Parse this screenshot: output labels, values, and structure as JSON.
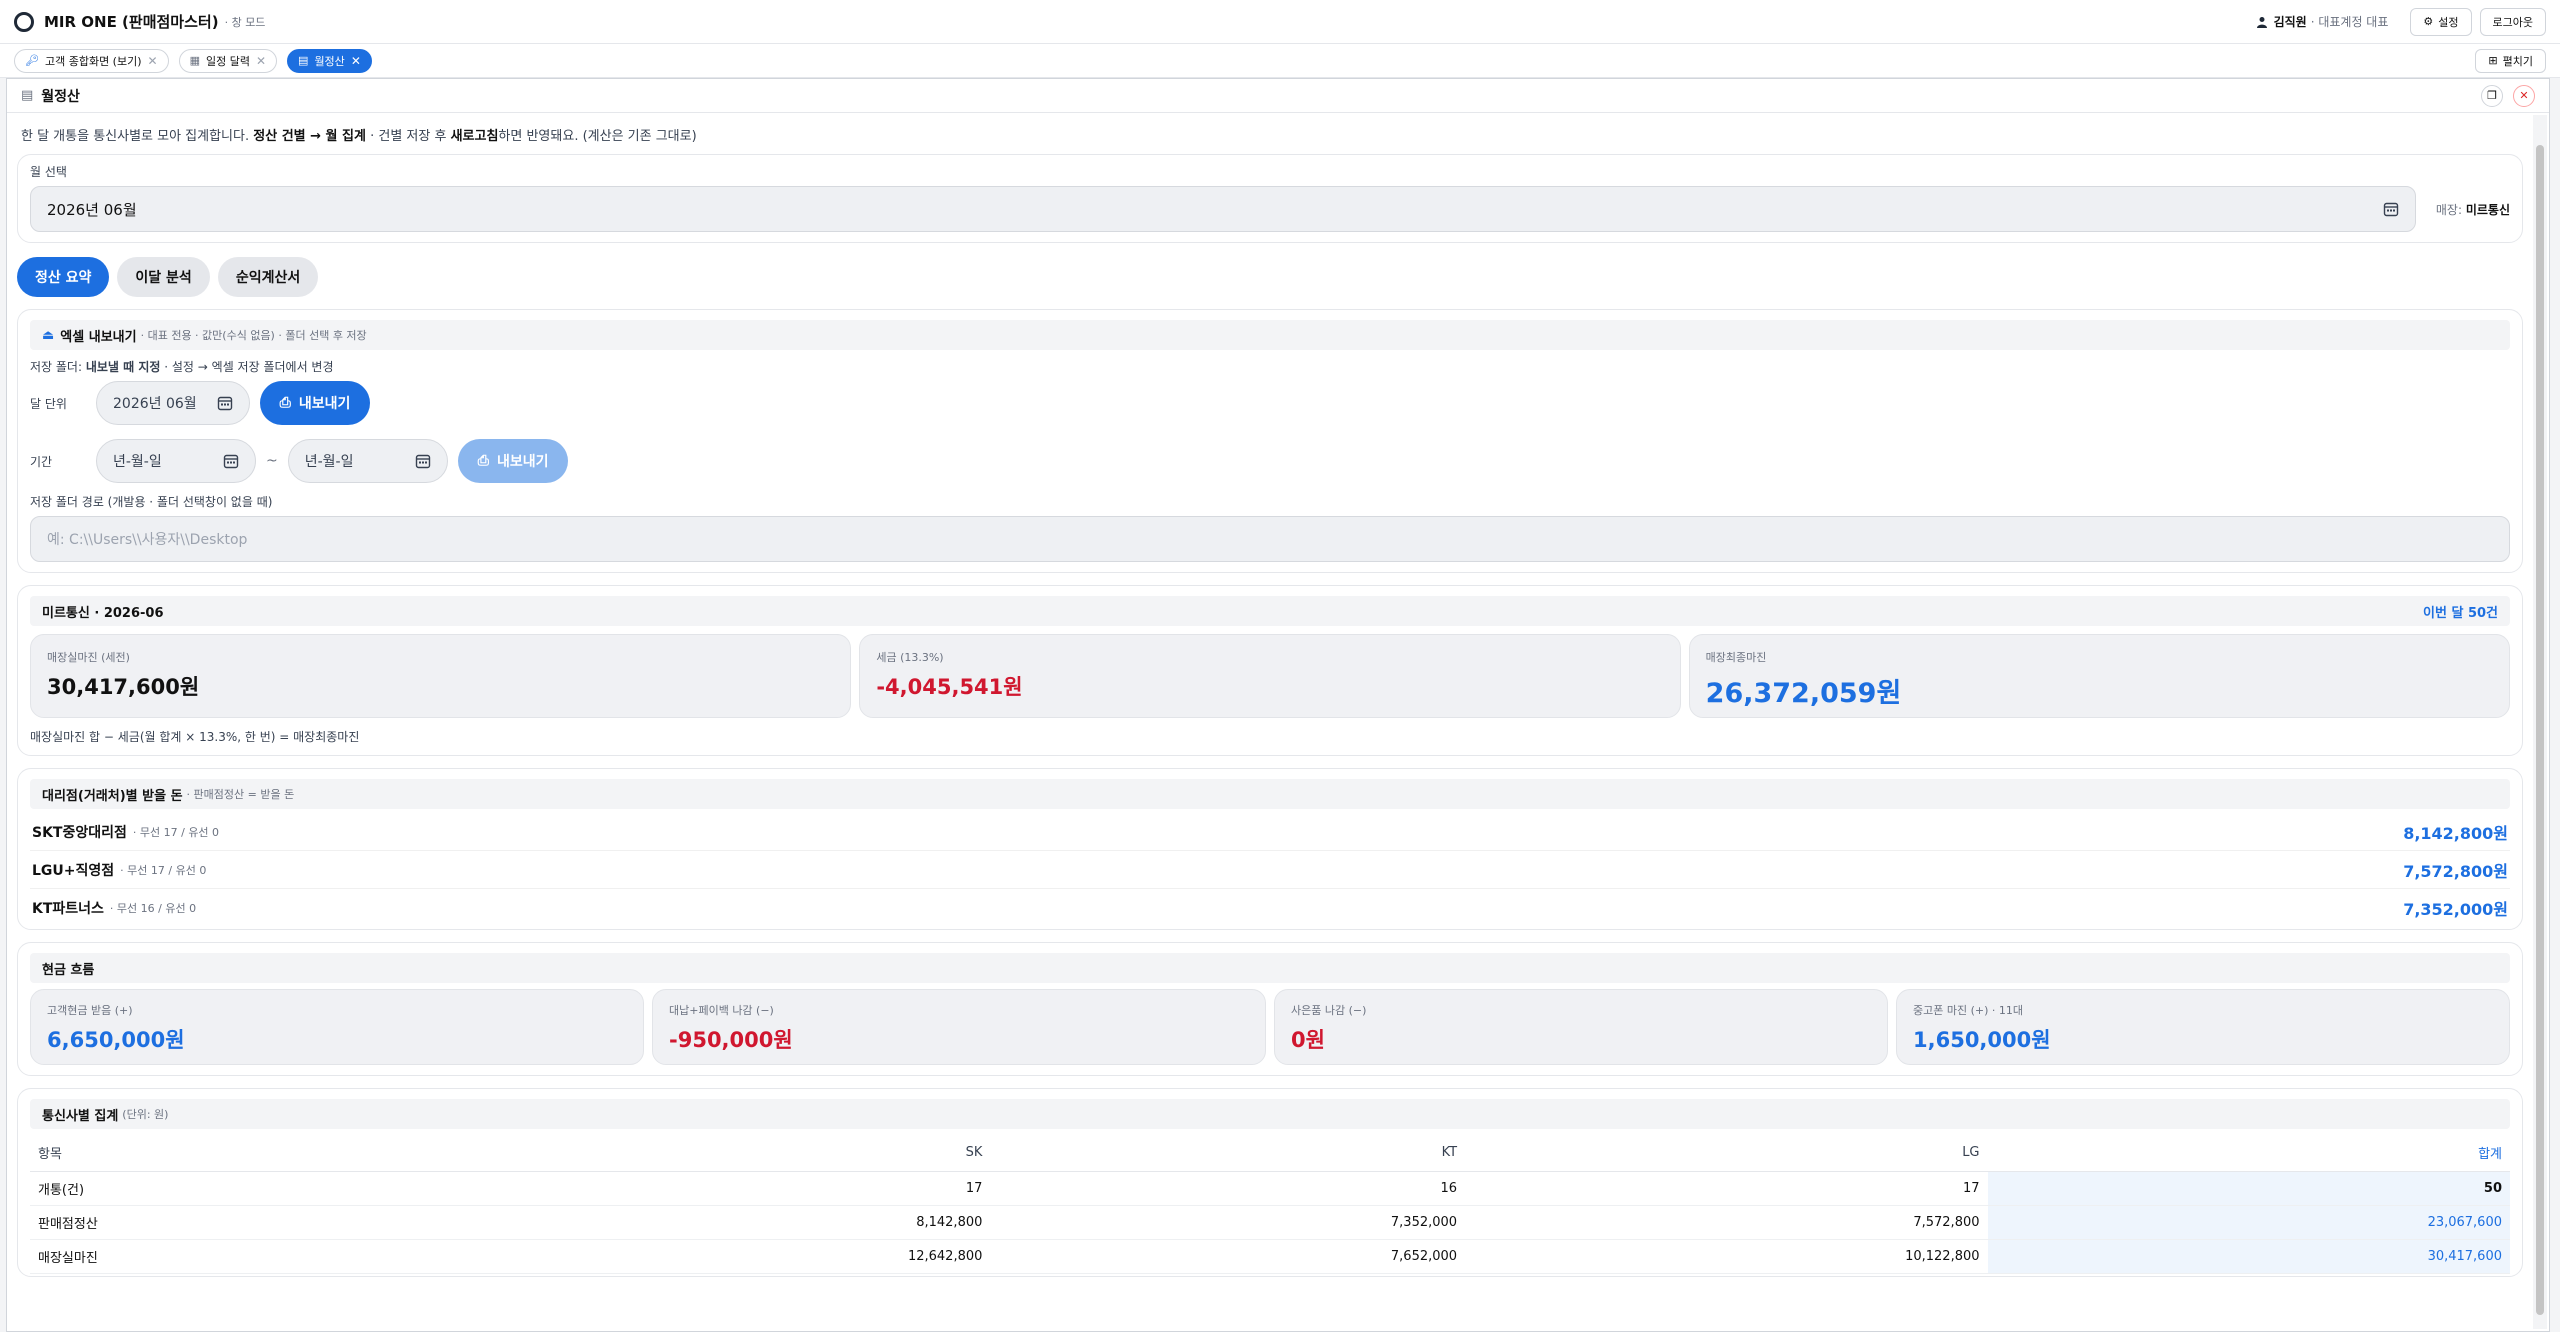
{
  "app": {
    "title": "MIR ONE (판매점마스터)",
    "mode": "· 창 모드"
  },
  "user": {
    "name": "김직원",
    "role": "· 대표계정 대표"
  },
  "topbar": {
    "settings": "설정",
    "logout": "로그아웃"
  },
  "tabs": [
    {
      "label": "고객 종합화면 (보기)"
    },
    {
      "label": "일정 달력"
    },
    {
      "label": "월정산"
    }
  ],
  "expand_label": "펼치기",
  "window": {
    "title": "월정산"
  },
  "desc": {
    "p1": "한 달 개통을 통신사별로 모아 집계합니다. ",
    "b1": "정산 건별 → 월 집계",
    "p2": " · 건별 저장 후 ",
    "b2": "새로고침",
    "p3": "하면 반영돼요. (계산은 기존 그대로)"
  },
  "month_select": {
    "label": "월 선택",
    "value": "2026년 06월",
    "store_label": "매장:",
    "store": "미르통신"
  },
  "subtabs": [
    {
      "label": "정산 요약"
    },
    {
      "label": "이달 분석"
    },
    {
      "label": "순익계산서"
    }
  ],
  "excel": {
    "title": "엑셀 내보내기",
    "sub": "· 대표 전용 · 값만(수식 없음) · 폴더 선택 후 저장",
    "folder_note_1": "저장 폴더: ",
    "folder_note_b": "내보낼 때 지정",
    "folder_note_2": " · 설정 → 엑셀 저장 폴더에서 변경",
    "month_label": "달 단위",
    "month_value": "2026년 06월",
    "export_label": "내보내기",
    "period_label": "기간",
    "period_from": "년-월-일",
    "period_sep": "~",
    "period_to": "년-월-일",
    "path_label": "저장 폴더 경로 (개발용 · 폴더 선택창이 없을 때)",
    "path_placeholder": "예: C:\\\\Users\\\\사용자\\\\Desktop"
  },
  "summary": {
    "title": "미르통신 · 2026-06",
    "count": "이번 달 50건",
    "stats": [
      {
        "label": "매장실마진 (세전)",
        "value": "30,417,600원"
      },
      {
        "label": "세금 (13.3%)",
        "value": "-4,045,541원"
      },
      {
        "label": "매장최종마진",
        "value": "26,372,059원"
      }
    ],
    "note": "매장실마진 합 − 세금(월 합계 × 13.3%, 한 번) = 매장최종마진"
  },
  "agencies": {
    "title": "대리점(거래처)별 받을 돈",
    "sub": "· 판매점정산 = 받을 돈",
    "items": [
      {
        "name": "SKT중앙대리점",
        "info": "· 무선 17 / 유선 0",
        "amount": "8,142,800원"
      },
      {
        "name": "LGU+직영점",
        "info": "· 무선 17 / 유선 0",
        "amount": "7,572,800원"
      },
      {
        "name": "KT파트너스",
        "info": "· 무선 16 / 유선 0",
        "amount": "7,352,000원"
      }
    ]
  },
  "cashflow": {
    "title": "현금 흐름",
    "items": [
      {
        "label": "고객현금 받음 (+)",
        "value": "6,650,000원"
      },
      {
        "label": "대납+페이백 나감 (−)",
        "value": "-950,000원"
      },
      {
        "label": "사은품 나감 (−)",
        "value": "0원"
      },
      {
        "label": "중고폰 마진 (+) · 11대",
        "value": "1,650,000원"
      }
    ]
  },
  "carrier_table": {
    "title": "통신사별 집계",
    "sub": "(단위: 원)",
    "headers": [
      "항목",
      "SK",
      "KT",
      "LG",
      "합계"
    ],
    "rows": [
      [
        "개통(건)",
        "17",
        "16",
        "17",
        "50"
      ],
      [
        "판매점정산",
        "8,142,800",
        "7,352,000",
        "7,572,800",
        "23,067,600"
      ],
      [
        "매장실마진",
        "12,642,800",
        "7,652,000",
        "10,122,800",
        "30,417,600"
      ]
    ]
  },
  "colors": {
    "accent": "#1d6fe0",
    "negative": "#d0172f"
  }
}
